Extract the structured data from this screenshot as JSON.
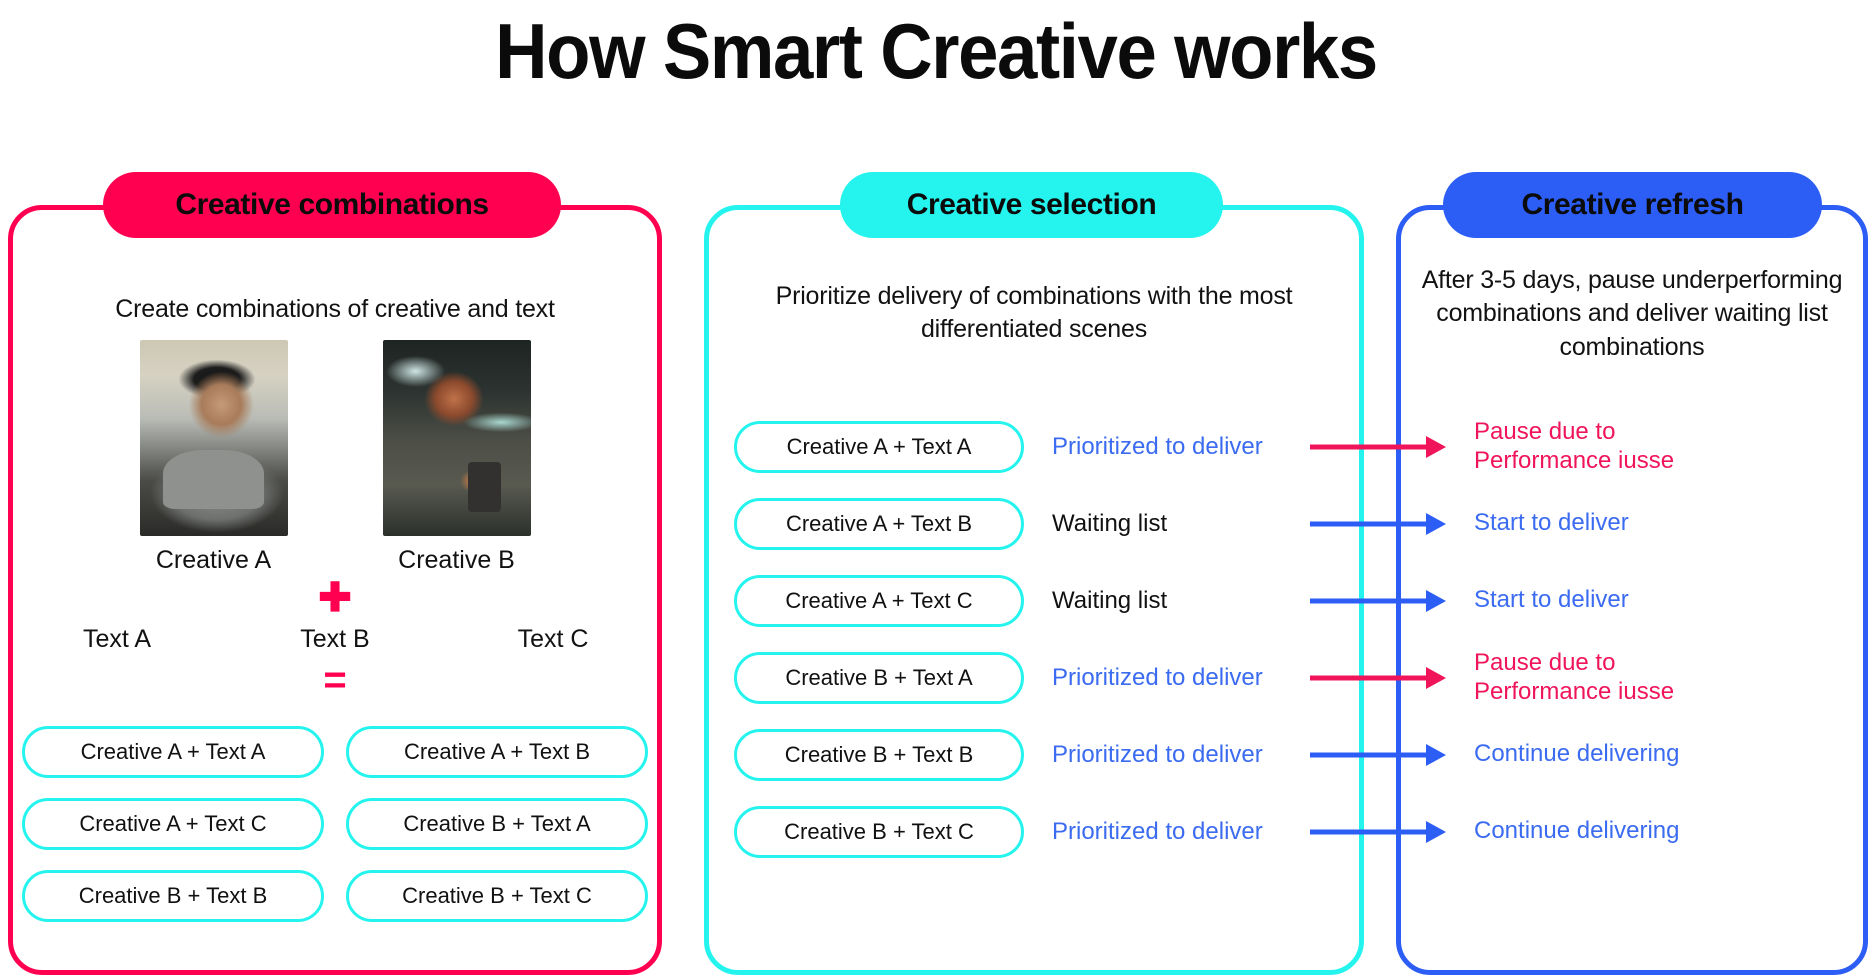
{
  "page": {
    "title": "How Smart Creative works"
  },
  "panels": {
    "combinations": {
      "header": "Creative combinations",
      "subtitle": "Create combinations of creative and text",
      "accent_color": "#FF0050",
      "creatives": [
        {
          "label": "Creative A",
          "image_alt": "person wearing a dark cowboy hat sitting in a car"
        },
        {
          "label": "Creative B",
          "image_alt": "man smiling while looking at a phone in a dim garage"
        }
      ],
      "plus_symbol": "✚",
      "equals_symbol": "=",
      "texts": [
        "Text A",
        "Text B",
        "Text C"
      ],
      "combination_pills": [
        "Creative A + Text A",
        "Creative A + Text B",
        "Creative A + Text C",
        "Creative B + Text A",
        "Creative B + Text B",
        "Creative B + Text C"
      ]
    },
    "selection": {
      "header": "Creative selection",
      "subtitle": "Prioritize delivery of combinations with the most differentiated scenes",
      "accent_color": "#25F4EE"
    },
    "refresh": {
      "header": "Creative refresh",
      "subtitle": "After 3-5 days, pause underperforming combinations and deliver waiting list combinations",
      "accent_color": "#2C5DF5"
    }
  },
  "flow_rows": [
    {
      "combination": "Creative A + Text A",
      "status": "Prioritized to deliver",
      "status_color": "blue",
      "arrow_color": "pink",
      "outcome": "Pause due to\nPerformance iusse",
      "outcome_color": "pink"
    },
    {
      "combination": "Creative A + Text B",
      "status": "Waiting list",
      "status_color": "black",
      "arrow_color": "blue",
      "outcome": "Start to deliver",
      "outcome_color": "blue"
    },
    {
      "combination": "Creative A + Text C",
      "status": "Waiting list",
      "status_color": "black",
      "arrow_color": "blue",
      "outcome": "Start to deliver",
      "outcome_color": "blue"
    },
    {
      "combination": "Creative B + Text A",
      "status": "Prioritized to deliver",
      "status_color": "blue",
      "arrow_color": "pink",
      "outcome": "Pause due to\nPerformance iusse",
      "outcome_color": "pink"
    },
    {
      "combination": "Creative B + Text B",
      "status": "Prioritized to deliver",
      "status_color": "blue",
      "arrow_color": "blue",
      "outcome": "Continue delivering",
      "outcome_color": "blue"
    },
    {
      "combination": "Creative B + Text C",
      "status": "Prioritized to deliver",
      "status_color": "blue",
      "arrow_color": "blue",
      "outcome": "Continue delivering",
      "outcome_color": "blue"
    }
  ]
}
